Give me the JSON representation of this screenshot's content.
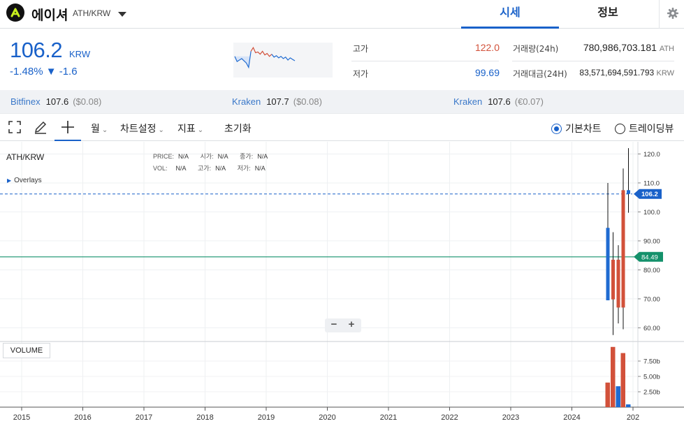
{
  "header": {
    "coin_name": "에이셔",
    "pair": "ATH/KRW",
    "tabs": [
      {
        "label": "시세",
        "active": true
      },
      {
        "label": "정보",
        "active": false
      }
    ]
  },
  "price": {
    "current": "106.2",
    "unit": "KRW",
    "change": "-1.48% ▼ -1.6",
    "trend_color": "#1961c9"
  },
  "stats": {
    "high_label": "고가",
    "high_value": "122.0",
    "low_label": "저가",
    "low_value": "99.69",
    "volume_label": "거래량(24h)",
    "volume_value": "780,986,703.181",
    "volume_unit": "ATH",
    "turnover_label": "거래대금(24H)",
    "turnover_value": "83,571,694,591.793",
    "turnover_unit": "KRW"
  },
  "exchanges": [
    {
      "name": "Bitfinex",
      "price": "107.6",
      "delta": "($0.08)"
    },
    {
      "name": "Kraken",
      "price": "107.7",
      "delta": "($0.08)"
    },
    {
      "name": "Kraken",
      "price": "107.6",
      "delta": "(€0.07)"
    }
  ],
  "toolbar": {
    "interval": "월",
    "chart_settings": "차트설정",
    "indicators": "지표",
    "reset": "초기화",
    "view_basic": "기본차트",
    "view_trading": "트레이딩뷰",
    "selected_view": "기본차트"
  },
  "chart": {
    "symbol": "ATH/KRW",
    "overlays_label": "Overlays",
    "volume_label": "VOLUME",
    "ohlc_fields": [
      {
        "key": "PRICE:",
        "value": "N/A"
      },
      {
        "key": "시가:",
        "value": "N/A"
      },
      {
        "key": "종가:",
        "value": "N/A"
      },
      {
        "key": "VOL:",
        "value": "N/A"
      },
      {
        "key": "고가:",
        "value": "N/A"
      },
      {
        "key": "저가:",
        "value": "N/A"
      }
    ],
    "zoom_out": "−",
    "zoom_in": "+",
    "current_price_tag": "106.2",
    "level_tag": "84.49"
  },
  "chart_data": {
    "type": "candlestick",
    "x_ticks": [
      "2015",
      "2016",
      "2017",
      "2018",
      "2019",
      "2020",
      "2021",
      "2022",
      "2023",
      "2024",
      "202"
    ],
    "y_ticks": [
      "120.0",
      "110.0",
      "100.0",
      "90.00",
      "80.00",
      "70.00",
      "60.00"
    ],
    "ylim": [
      56,
      123
    ],
    "volume_ticks": [
      "7.50b",
      "5.00b",
      "2.50b"
    ],
    "volume_ylim": [
      0,
      10
    ],
    "current_price": 106.2,
    "horizontal_level": 84.49,
    "colors": {
      "up": "#1f6bd1",
      "down": "#d2513a",
      "level": "#14916b"
    },
    "candles": [
      {
        "open": 69.5,
        "close": 94.5,
        "high": 110.0,
        "low": 69.5,
        "direction": "up",
        "volume": 4.0
      },
      {
        "open": 83.5,
        "close": 69.8,
        "high": 93.0,
        "low": 57.5,
        "direction": "down",
        "volume": 9.8
      },
      {
        "open": 83.5,
        "close": 67.0,
        "high": 88.5,
        "low": 61.5,
        "direction": "down",
        "volume": 3.4
      },
      {
        "open": 67.0,
        "close": 107.5,
        "high": 115.0,
        "low": 59.5,
        "direction": "down",
        "volume": 8.8
      },
      {
        "open": 106.2,
        "close": 107.5,
        "high": 122.0,
        "low": 99.7,
        "direction": "up",
        "volume": 0.45
      }
    ]
  },
  "sparkline": {
    "color_up": "#d2513a",
    "color_down": "#1f6bd1",
    "points": [
      85,
      78,
      80,
      82,
      79,
      76,
      70,
      92,
      97,
      90,
      91,
      88,
      92,
      87,
      89,
      85,
      88,
      84,
      86,
      83,
      85,
      82,
      84,
      80,
      83,
      81,
      79
    ]
  }
}
